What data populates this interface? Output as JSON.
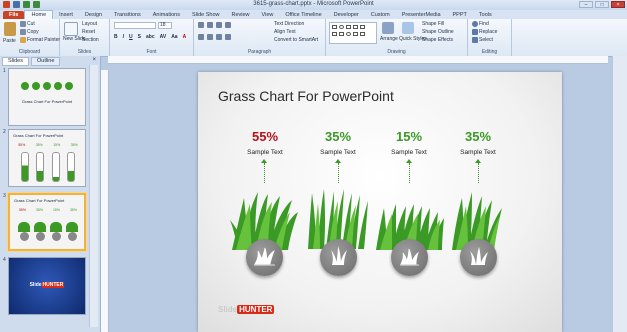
{
  "window": {
    "title": "3615-grass-chart.pptx - Microsoft PowerPoint"
  },
  "tabs": [
    "File",
    "Home",
    "Insert",
    "Design",
    "Transitions",
    "Animations",
    "Slide Show",
    "Review",
    "View",
    "Office Timeline",
    "Developer",
    "Custom",
    "PresenterMedia",
    "PPPT",
    "Tools"
  ],
  "ribbon": {
    "clipboard": {
      "paste": "Paste",
      "cut": "Cut",
      "copy": "Copy",
      "format_painter": "Format Painter",
      "label": "Clipboard"
    },
    "slides": {
      "new_slide": "New Slide",
      "layout": "Layout",
      "reset": "Reset",
      "section": "Section",
      "label": "Slides"
    },
    "font": {
      "label": "Font",
      "size": "18",
      "buttons": [
        "B",
        "I",
        "U",
        "S",
        "abc",
        "AV",
        "Aa",
        "A"
      ]
    },
    "paragraph": {
      "label": "Paragraph",
      "text_direction": "Text Direction",
      "align_text": "Align Text",
      "convert": "Convert to SmartArt"
    },
    "drawing": {
      "label": "Drawing",
      "arrange": "Arrange",
      "quick_styles": "Quick Styles",
      "shape_fill": "Shape Fill",
      "shape_outline": "Shape Outline",
      "shape_effects": "Shape Effects"
    },
    "editing": {
      "label": "Editing",
      "find": "Find",
      "replace": "Replace",
      "select": "Select"
    }
  },
  "pane": {
    "tabs": [
      "Slides",
      "Outline"
    ],
    "close": "×",
    "slide_numbers": [
      "1",
      "2",
      "3",
      "4"
    ]
  },
  "slide": {
    "title": "Grass Chart For PowerPoint",
    "columns": [
      {
        "percent": "55%",
        "label": "Sample Text",
        "color": "#b5121b"
      },
      {
        "percent": "35%",
        "label": "Sample Text",
        "color": "#3a9a25"
      },
      {
        "percent": "15%",
        "label": "Sample Text",
        "color": "#3a9a25"
      },
      {
        "percent": "35%",
        "label": "Sample Text",
        "color": "#3a9a25"
      }
    ],
    "logo": {
      "part1": "Slide",
      "part2": "HUNTER"
    }
  },
  "thumb1": {
    "title": "Grass Chart For PowerPoint"
  },
  "thumb2": {
    "title": "Grass Chart For PowerPoint",
    "values": [
      "55%",
      "35%",
      "15%",
      "35%"
    ]
  },
  "thumb3": {
    "title": "Grass Chart For PowerPoint",
    "values": [
      "55%",
      "35%",
      "15%",
      "35%"
    ]
  },
  "thumb4": {
    "logo1": "Slide",
    "logo2": "HUNTER"
  }
}
